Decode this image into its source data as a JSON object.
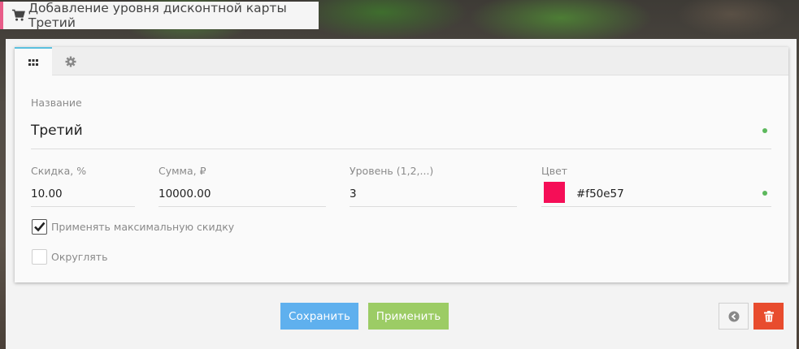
{
  "header": {
    "title": "Добавление уровня дисконтной карты Третий",
    "cart_icon": "shopping-cart-icon"
  },
  "tabs": [
    {
      "icon": "grid-icon",
      "active": true
    },
    {
      "icon": "gear-icon",
      "active": false
    }
  ],
  "form": {
    "name": {
      "label": "Название",
      "value": "Третий"
    },
    "discount": {
      "label": "Скидка, %",
      "value": "10.00"
    },
    "sum": {
      "label": "Сумма, ₽",
      "value": "10000.00"
    },
    "level": {
      "label": "Уровень (1,2,...)",
      "value": "3"
    },
    "color": {
      "label": "Цвет",
      "value": "#f50e57",
      "swatch": "#f50e57"
    },
    "max_discount": {
      "label": "Применять максимальную скидку",
      "checked": true
    },
    "round": {
      "label": "Округлять",
      "checked": false
    },
    "status_color": "#5cb85c"
  },
  "actions": {
    "save_label": "Сохранить",
    "apply_label": "Применить",
    "back_icon": "arrow-left-circle-icon",
    "delete_icon": "trash-icon",
    "save_color": "#5fb0ee",
    "apply_color": "#9ccc65",
    "delete_color": "#e84c2e"
  }
}
